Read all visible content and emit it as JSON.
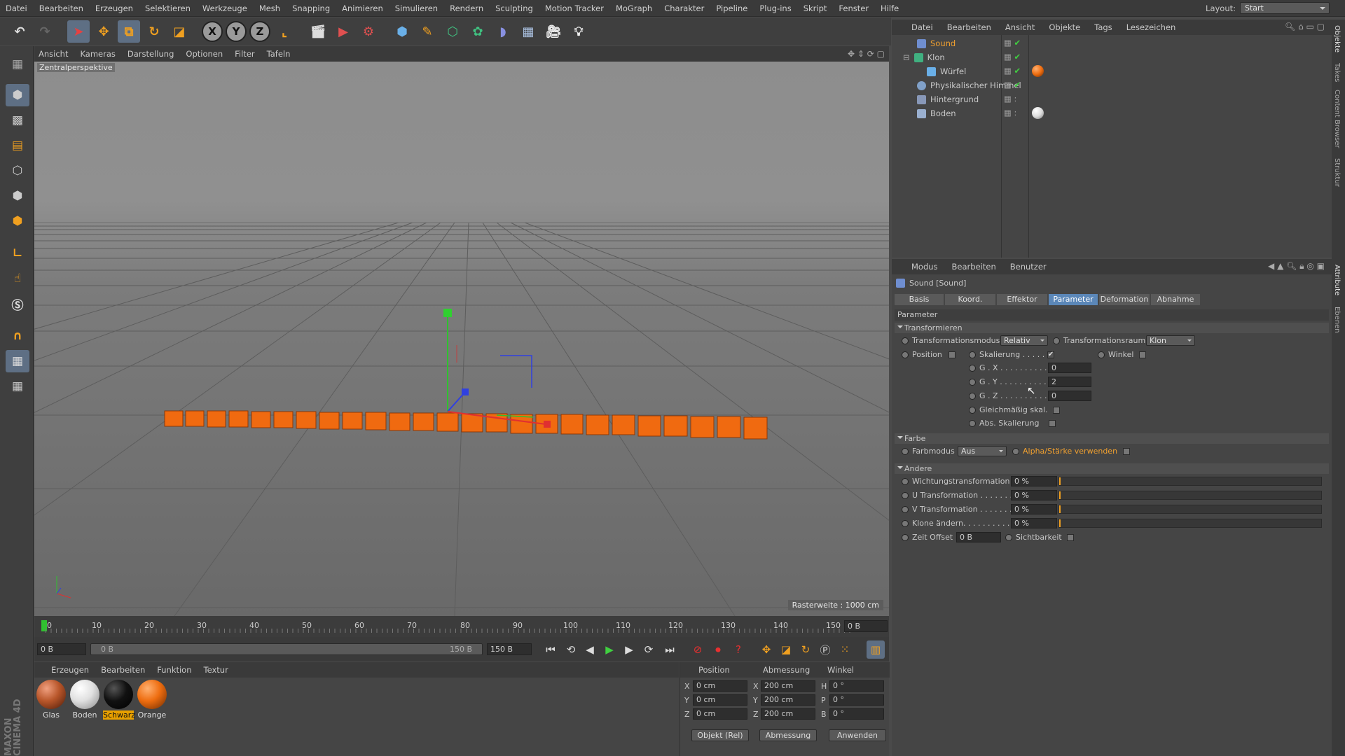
{
  "menubar": {
    "items": [
      "Datei",
      "Bearbeiten",
      "Erzeugen",
      "Selektieren",
      "Werkzeuge",
      "Mesh",
      "Snapping",
      "Animieren",
      "Simulieren",
      "Rendern",
      "Sculpting",
      "Motion Tracker",
      "MoGraph",
      "Charakter",
      "Pipeline",
      "Plug-ins",
      "Skript",
      "Fenster",
      "Hilfe"
    ],
    "layout_label": "Layout:",
    "layout_value": "Start"
  },
  "toolbar": {
    "icons": [
      "undo-icon",
      "redo-icon",
      "select-arrow-icon",
      "move-icon",
      "scale-icon",
      "rotate-icon",
      "scale-icon",
      "x-axis-icon",
      "y-axis-icon",
      "z-axis-icon",
      "coordinate-system-icon",
      "render-view-icon",
      "render-picture-queue-icon",
      "render-settings-icon",
      "cube-primitive-icon",
      "pen-spline-icon",
      "subdivision-icon",
      "cloner-icon",
      "deformer-icon",
      "floor-icon",
      "camera-icon",
      "light-icon"
    ],
    "axis_labels": [
      "X",
      "Y",
      "Z"
    ]
  },
  "viewport": {
    "menu": [
      "Ansicht",
      "Kameras",
      "Darstellung",
      "Optionen",
      "Filter",
      "Tafeln"
    ],
    "camera_label": "Zentralperspektive",
    "grid_spacing": "Rasterweite : 1000 cm"
  },
  "timeline": {
    "ticks": [
      "0",
      "10",
      "20",
      "30",
      "40",
      "50",
      "60",
      "70",
      "80",
      "90",
      "100",
      "110",
      "120",
      "130",
      "140",
      "150"
    ],
    "current_frame": "0 B",
    "start": "0 B",
    "range_start": "0 B",
    "range_end": "150 B",
    "end": "150 B"
  },
  "materials": {
    "menu": [
      "Erzeugen",
      "Bearbeiten",
      "Funktion",
      "Textur"
    ],
    "items": [
      {
        "name": "Glas",
        "color": "#b8562a"
      },
      {
        "name": "Boden",
        "color": "#f0f0f0"
      },
      {
        "name": "Schwarz",
        "color": "#111111"
      },
      {
        "name": "Orange",
        "color": "#ee6d10"
      }
    ]
  },
  "coords": {
    "headers": [
      "Position",
      "Abmessung",
      "Winkel"
    ],
    "rows": [
      {
        "axis": "X",
        "pos": "0 cm",
        "size_axis": "X",
        "size": "200 cm",
        "rot_axis": "H",
        "rot": "0 °"
      },
      {
        "axis": "Y",
        "pos": "0 cm",
        "size_axis": "Y",
        "size": "200 cm",
        "rot_axis": "P",
        "rot": "0 °"
      },
      {
        "axis": "Z",
        "pos": "0 cm",
        "size_axis": "Z",
        "size": "200 cm",
        "rot_axis": "B",
        "rot": "0 °"
      }
    ],
    "mode": "Objekt (Rel)",
    "size_mode": "Abmessung",
    "apply": "Anwenden"
  },
  "objects": {
    "menu": [
      "Datei",
      "Bearbeiten",
      "Ansicht",
      "Objekte",
      "Tags",
      "Lesezeichen"
    ],
    "items": [
      {
        "name": "Sound",
        "icon": "sound-effector-icon",
        "selected": true
      },
      {
        "name": "Klon",
        "icon": "cloner-icon"
      },
      {
        "name": "Würfel",
        "icon": "cube-icon"
      },
      {
        "name": "Physikalischer Himmel",
        "icon": "sky-icon"
      },
      {
        "name": "Hintergrund",
        "icon": "background-icon"
      },
      {
        "name": "Boden",
        "icon": "floor-icon"
      }
    ]
  },
  "attributes": {
    "menu": [
      "Modus",
      "Bearbeiten",
      "Benutzer"
    ],
    "title": "Sound [Sound]",
    "tabs": [
      "Basis",
      "Koord.",
      "Effektor",
      "Parameter",
      "Deformation",
      "Abnahme"
    ],
    "active_tab": "Parameter",
    "section_label": "Parameter",
    "transform": {
      "header": "Transformieren",
      "mode_label": "Transformationsmodus",
      "mode_value": "Relativ",
      "space_label": "Transformationsraum",
      "space_value": "Klon",
      "position": "Position",
      "scale": "Skalierung . . . . .",
      "angle": "Winkel",
      "sx_label": "G . X . . . . . . . . . . .",
      "sx": "0",
      "sy_label": "G . Y . . . . . . . . . . .",
      "sy": "2",
      "sz_label": "G . Z . . . . . . . . . . .",
      "sz": "0",
      "uniform": "Gleichmäßig skal.",
      "abs_scale": "Abs. Skalierung"
    },
    "color": {
      "header": "Farbe",
      "mode_label": "Farbmodus",
      "mode_value": "Aus",
      "alpha": "Alpha/Stärke verwenden"
    },
    "other": {
      "header": "Andere",
      "weight": "Wichtungstransformation",
      "weight_value": "0 %",
      "u": "U Transformation . . . . . . .",
      "u_value": "0 %",
      "v": "V Transformation . . . . . . .",
      "v_value": "0 %",
      "clones": "Klone ändern. . . . . . . . . . .",
      "clones_value": "0 %",
      "time_offset": "Zeit Offset",
      "time_offset_value": "0 B",
      "visibility": "Sichtbarkeit"
    }
  },
  "sidetabs": [
    "Objekte",
    "Takes",
    "Content Browser",
    "Struktur",
    "Attribute",
    "Ebenen"
  ]
}
